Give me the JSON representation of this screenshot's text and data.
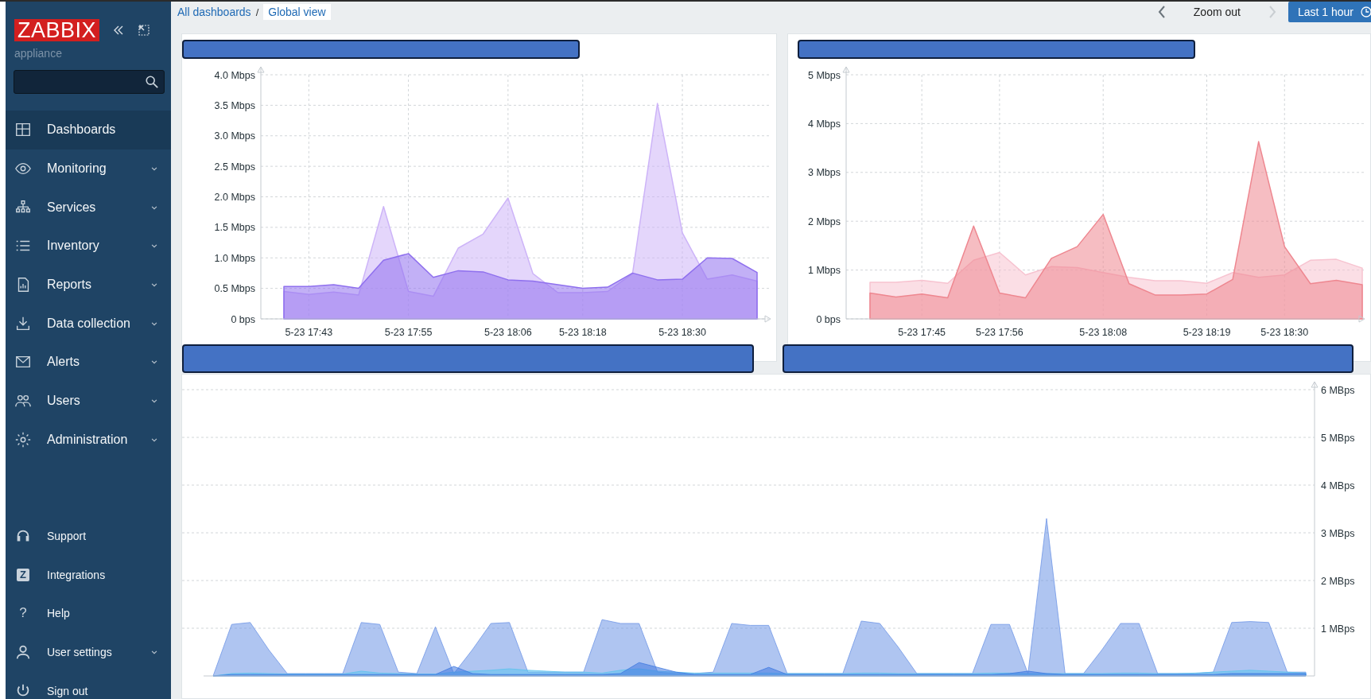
{
  "sidebar": {
    "logo": "ZABBIX",
    "server_name": "appliance",
    "menu": [
      {
        "label": "Dashboards",
        "selected": true,
        "expandable": false
      },
      {
        "label": "Monitoring",
        "selected": false,
        "expandable": true
      },
      {
        "label": "Services",
        "selected": false,
        "expandable": true
      },
      {
        "label": "Inventory",
        "selected": false,
        "expandable": true
      },
      {
        "label": "Reports",
        "selected": false,
        "expandable": true
      },
      {
        "label": "Data collection",
        "selected": false,
        "expandable": true
      },
      {
        "label": "Alerts",
        "selected": false,
        "expandable": true
      },
      {
        "label": "Users",
        "selected": false,
        "expandable": true
      },
      {
        "label": "Administration",
        "selected": false,
        "expandable": true
      }
    ],
    "footer_menu": [
      {
        "label": "Support",
        "expandable": false
      },
      {
        "label": "Integrations",
        "glyph": "Z",
        "expandable": false
      },
      {
        "label": "Help",
        "glyph": "?",
        "expandable": false
      },
      {
        "label": "User settings",
        "expandable": true
      },
      {
        "label": "Sign out",
        "expandable": false
      }
    ]
  },
  "breadcrumbs": {
    "separator": "/",
    "items": [
      {
        "label": "All dashboards",
        "current": false
      },
      {
        "label": "Global view",
        "current": true
      }
    ]
  },
  "time_controls": {
    "zoom_out": "Zoom out",
    "next_disabled": true,
    "period": "Last 1 hour"
  },
  "widgets": [
    {
      "chart_data": {
        "type": "area",
        "categories": [
          null,
          "5-23 17:43",
          null,
          null,
          null,
          "5-23 17:55",
          null,
          null,
          null,
          "5-23 18:06",
          null,
          null,
          "5-23 18:18",
          null,
          null,
          null,
          "5-23 18:30",
          null,
          null,
          null
        ],
        "grid": true,
        "ylim": [
          0,
          4
        ],
        "yticks": [
          {
            "value": 0,
            "label": "0 bps"
          },
          {
            "value": 0.5,
            "label": "0.5 Mbps"
          },
          {
            "value": 1,
            "label": "1.0 Mbps"
          },
          {
            "value": 1.5,
            "label": "1.5 Mbps"
          },
          {
            "value": 2,
            "label": "2.0 Mbps"
          },
          {
            "value": 2.5,
            "label": "2.5 Mbps"
          },
          {
            "value": 3,
            "label": "3.0 Mbps"
          },
          {
            "value": 3.5,
            "label": "3.5 Mbps"
          },
          {
            "value": 4,
            "label": "4.0 Mbps"
          }
        ],
        "series": [
          {
            "color": "#cdb4f8",
            "values": [
              0.45,
              0.4,
              0.44,
              0.39,
              1.84,
              0.45,
              0.37,
              1.16,
              1.39,
              1.98,
              0.74,
              0.43,
              0.43,
              0.45,
              0.74,
              3.53,
              1.41,
              0.65,
              0.72,
              0.62
            ]
          },
          {
            "color": "#8f70ee",
            "values": [
              0.53,
              0.53,
              0.56,
              0.5,
              0.96,
              1.07,
              0.68,
              0.79,
              0.77,
              0.64,
              0.62,
              0.56,
              0.5,
              0.52,
              0.75,
              0.64,
              0.65,
              1.0,
              0.99,
              0.76
            ]
          }
        ]
      }
    },
    {
      "chart_data": {
        "type": "area",
        "categories": [
          null,
          null,
          "5-23 17:45",
          null,
          null,
          "5-23 17:56",
          null,
          null,
          null,
          "5-23 18:08",
          null,
          null,
          null,
          "5-23 18:19",
          null,
          null,
          "5-23 18:30",
          null,
          null,
          null
        ],
        "grid": true,
        "ylim": [
          0,
          5
        ],
        "yticks": [
          {
            "value": 0,
            "label": "0 bps"
          },
          {
            "value": 1,
            "label": "1 Mbps"
          },
          {
            "value": 2,
            "label": "2 Mbps"
          },
          {
            "value": 3,
            "label": "3 Mbps"
          },
          {
            "value": 4,
            "label": "4 Mbps"
          },
          {
            "value": 5,
            "label": "5 Mbps"
          }
        ],
        "series": [
          {
            "color": "#f7c3d0",
            "values": [
              0.75,
              0.75,
              0.79,
              0.73,
              1.2,
              1.36,
              0.9,
              1.07,
              1.05,
              0.95,
              0.85,
              0.78,
              0.78,
              0.73,
              0.95,
              0.85,
              0.9,
              1.2,
              1.22,
              1.04
            ]
          },
          {
            "color": "#ee8790",
            "values": [
              0.53,
              0.45,
              0.51,
              0.43,
              1.9,
              0.53,
              0.43,
              1.24,
              1.48,
              2.14,
              0.72,
              0.49,
              0.49,
              0.51,
              0.81,
              3.63,
              1.48,
              0.72,
              0.79,
              0.7
            ]
          }
        ]
      }
    },
    {
      "chart_data": {
        "type": "area",
        "categories": [
          null,
          null,
          null,
          null,
          null,
          null,
          null,
          null,
          null,
          null,
          null,
          null,
          null,
          null,
          null,
          null,
          null,
          null,
          null,
          null,
          null,
          null,
          null,
          null,
          null,
          null,
          null,
          null,
          null,
          null,
          null,
          null,
          null,
          null,
          null,
          null,
          null,
          null,
          null,
          null,
          null,
          null,
          null,
          null,
          null,
          null,
          null,
          null,
          null,
          null,
          null,
          null,
          null,
          null,
          null,
          null,
          null,
          null,
          null,
          null
        ],
        "grid": true,
        "ylim": [
          0,
          6
        ],
        "yticks": [
          {
            "value": 1,
            "label": "1 MBps"
          },
          {
            "value": 2,
            "label": "2 MBps"
          },
          {
            "value": 3,
            "label": "3 MBps"
          },
          {
            "value": 4,
            "label": "4 MBps"
          },
          {
            "value": 5,
            "label": "5 MBps"
          },
          {
            "value": 6,
            "label": "6 MBps"
          }
        ],
        "series": [
          {
            "color": "#6e95e6",
            "values": [
              0,
              1.08,
              1.12,
              0.55,
              0.05,
              0.05,
              0.05,
              0.05,
              1.12,
              1.08,
              0.08,
              0.05,
              1.03,
              0.05,
              0.55,
              1.1,
              1.12,
              0.08,
              0.08,
              0.08,
              0.08,
              1.18,
              1.1,
              1.1,
              0.08,
              0.05,
              0.05,
              0.08,
              1.1,
              1.06,
              1.06,
              0.05,
              0.05,
              0.05,
              0.05,
              1.15,
              1.1,
              0.6,
              0.05,
              0.05,
              0.05,
              0.05,
              1.08,
              1.08,
              0.05,
              3.3,
              0.05,
              0.05,
              0.55,
              1.1,
              1.1,
              0.05,
              0.05,
              0.05,
              0.08,
              1.12,
              1.14,
              1.12,
              0.08,
              0.08
            ]
          },
          {
            "color": "#5cc3ee",
            "values": [
              0,
              0.05,
              0.06,
              0.05,
              0.04,
              0.04,
              0.04,
              0.04,
              0.1,
              0.06,
              0.05,
              0.04,
              0.04,
              0.08,
              0.1,
              0.12,
              0.15,
              0.12,
              0.1,
              0.08,
              0.08,
              0.06,
              0.12,
              0.15,
              0.1,
              0.08,
              0.06,
              0.06,
              0.06,
              0.06,
              0.06,
              0.05,
              0.05,
              0.05,
              0.05,
              0.06,
              0.06,
              0.05,
              0.05,
              0.05,
              0.05,
              0.05,
              0.06,
              0.06,
              0.05,
              0.05,
              0.05,
              0.05,
              0.05,
              0.06,
              0.06,
              0.05,
              0.05,
              0.06,
              0.08,
              0.1,
              0.12,
              0.1,
              0.08,
              0.06
            ]
          },
          {
            "color": "#3f78e0",
            "values": [
              0,
              0.03,
              0.03,
              0.03,
              0.03,
              0.03,
              0.03,
              0.03,
              0.03,
              0.03,
              0.03,
              0.03,
              0.03,
              0.2,
              0.05,
              0.03,
              0.03,
              0.03,
              0.03,
              0.03,
              0.03,
              0.03,
              0.05,
              0.28,
              0.18,
              0.08,
              0.03,
              0.03,
              0.03,
              0.03,
              0.18,
              0.03,
              0.03,
              0.03,
              0.03,
              0.03,
              0.03,
              0.03,
              0.03,
              0.03,
              0.03,
              0.03,
              0.03,
              0.05,
              0.1,
              0.05,
              0.03,
              0.03,
              0.03,
              0.03,
              0.03,
              0.03,
              0.03,
              0.03,
              0.03,
              0.05,
              0.05,
              0.05,
              0.05,
              0.05
            ]
          }
        ]
      }
    }
  ]
}
